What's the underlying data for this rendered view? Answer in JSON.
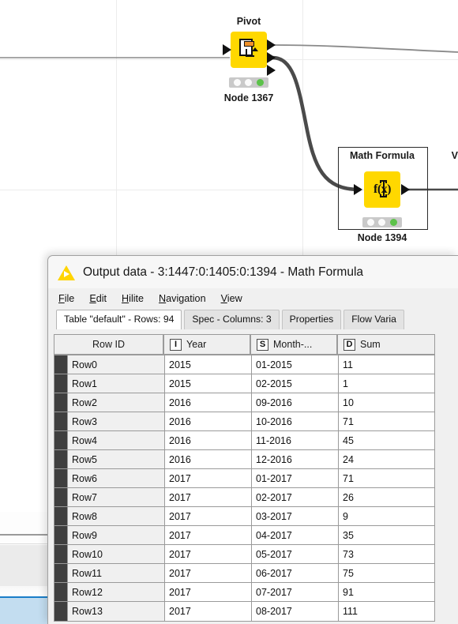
{
  "canvas": {
    "nodes": [
      {
        "title": "Pivot",
        "label": "Node 1367",
        "icon": "pivot-icon",
        "status": "executed",
        "inputs": 1,
        "outputs": 3
      },
      {
        "title": "Math Formula",
        "label": "Node 1394",
        "icon": "fx-icon",
        "icon_text": "f(x)",
        "status": "executed",
        "inputs": 1,
        "outputs": 1,
        "selected": true
      },
      {
        "title": "V",
        "label": "",
        "icon": "",
        "status": "",
        "clipped": true
      }
    ]
  },
  "dialog": {
    "title": "Output data - 3:1447:0:1405:0:1394 - Math Formula",
    "icon": "knime-triangle-icon",
    "menus": [
      {
        "label": "File",
        "mnemonic": "F"
      },
      {
        "label": "Edit",
        "mnemonic": "E"
      },
      {
        "label": "Hilite",
        "mnemonic": "H"
      },
      {
        "label": "Navigation",
        "mnemonic": "N"
      },
      {
        "label": "View",
        "mnemonic": "V"
      }
    ],
    "tabs": [
      {
        "label": "Table \"default\" - Rows: 94",
        "active": true
      },
      {
        "label": "Spec - Columns: 3",
        "active": false
      },
      {
        "label": "Properties",
        "active": false
      },
      {
        "label": "Flow Varia",
        "active": false
      }
    ],
    "table": {
      "columns": [
        {
          "label": "Row ID",
          "type_icon": ""
        },
        {
          "label": "Year",
          "type_icon": "I"
        },
        {
          "label": "Month-...",
          "type_icon": "S"
        },
        {
          "label": "Sum",
          "type_icon": "D"
        }
      ],
      "rows": [
        [
          "Row0",
          "2015",
          "01-2015",
          "11"
        ],
        [
          "Row1",
          "2015",
          "02-2015",
          "1"
        ],
        [
          "Row2",
          "2016",
          "09-2016",
          "10"
        ],
        [
          "Row3",
          "2016",
          "10-2016",
          "71"
        ],
        [
          "Row4",
          "2016",
          "11-2016",
          "45"
        ],
        [
          "Row5",
          "2016",
          "12-2016",
          "24"
        ],
        [
          "Row6",
          "2017",
          "01-2017",
          "71"
        ],
        [
          "Row7",
          "2017",
          "02-2017",
          "26"
        ],
        [
          "Row8",
          "2017",
          "03-2017",
          "9"
        ],
        [
          "Row9",
          "2017",
          "04-2017",
          "35"
        ],
        [
          "Row10",
          "2017",
          "05-2017",
          "73"
        ],
        [
          "Row11",
          "2017",
          "06-2017",
          "75"
        ],
        [
          "Row12",
          "2017",
          "07-2017",
          "91"
        ],
        [
          "Row13",
          "2017",
          "08-2017",
          "111"
        ]
      ]
    }
  },
  "colors": {
    "node_yellow": "#ffd800",
    "status_green": "#5cc24a",
    "knime_yellow": "#ffd400",
    "selection_blue": "#c3ddf0",
    "accent_blue": "#1a7ec8"
  }
}
